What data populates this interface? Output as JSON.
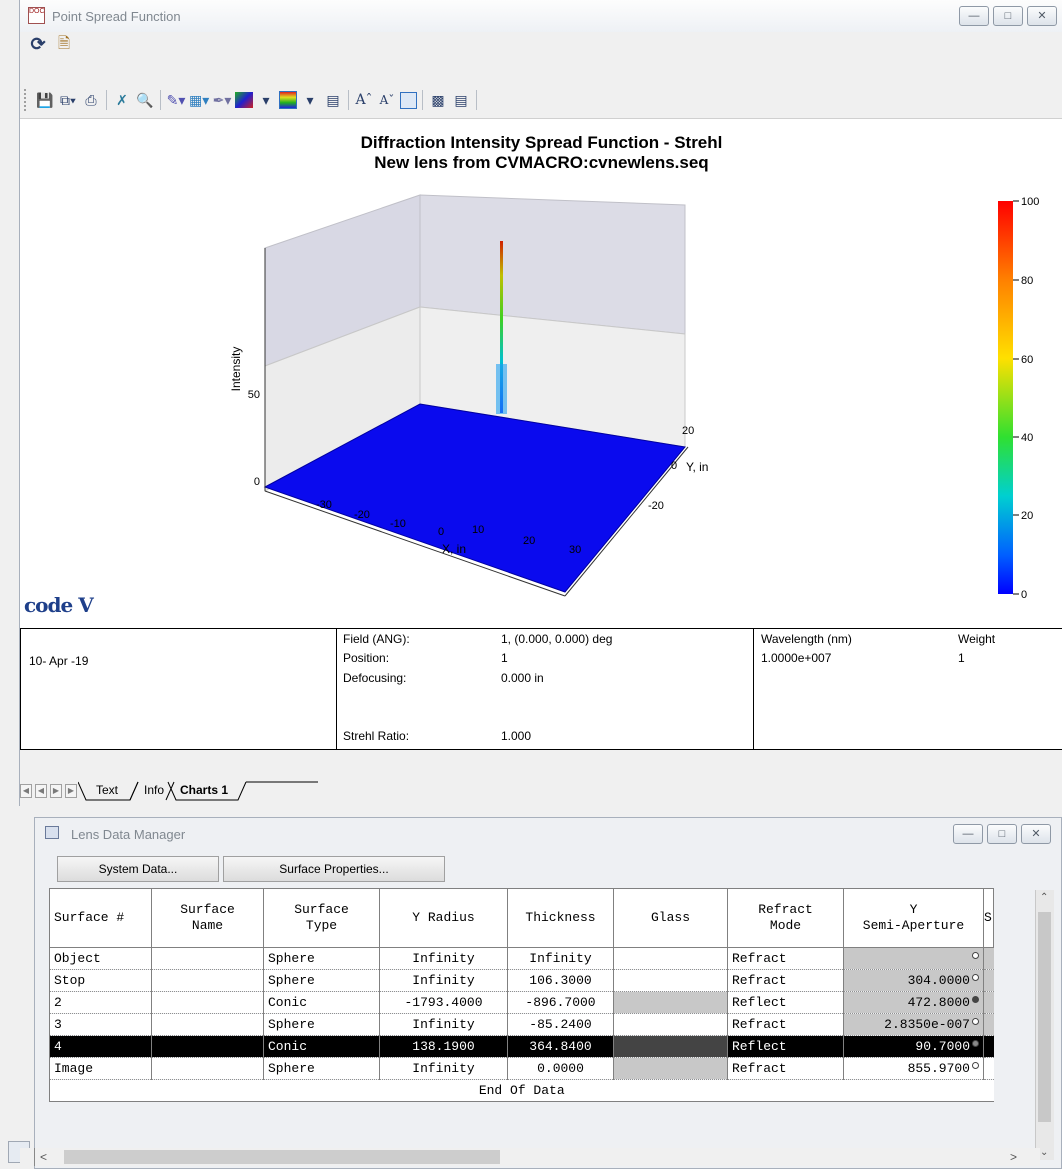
{
  "psf_window": {
    "title": "Point Spread Function",
    "icon": "document-icon",
    "controls": [
      "minimize-icon",
      "maximize-icon",
      "close-icon"
    ]
  },
  "toolbar_top": [
    "refresh-icon",
    "export-icon"
  ],
  "toolbar_main": [
    "save-icon",
    "copy-icon",
    "print-icon",
    "fit-icon",
    "zoom-icon",
    "paint-icon",
    "color-map-icon",
    "brush-icon",
    "gradient-icon",
    "legend-icon",
    "table-icon",
    "font-up-icon",
    "font-down-icon",
    "frame-icon",
    "grid-icon",
    "list-icon"
  ],
  "chart": {
    "title_line1": "Diffraction Intensity Spread Function - Strehl",
    "title_line2": "New lens from CVMACRO:cvnewlens.seq",
    "logo": "code V"
  },
  "chart_data": {
    "type": "surface3d",
    "title": "Diffraction Intensity Spread Function - Strehl",
    "subtitle": "New lens from CVMACRO:cvnewlens.seq",
    "xlabel": "X, in",
    "ylabel": "Y, in",
    "zlabel": "Intensity",
    "x_ticks": [
      "-30",
      "-20",
      "-10",
      "0",
      "10",
      "20",
      "30"
    ],
    "y_ticks": [
      "20",
      "0",
      "-20"
    ],
    "z_ticks": [
      "0",
      "50"
    ],
    "peak": {
      "x": 0,
      "y": 0,
      "z": 100
    },
    "colorbar": {
      "ticks": [
        "100",
        "80",
        "60",
        "40",
        "20",
        "0"
      ],
      "min": 0,
      "max": 100
    }
  },
  "info": {
    "date": "10- Apr -19",
    "field_label": "Field (ANG):",
    "field_value": "1, (0.000, 0.000) deg",
    "position_label": "Position:",
    "position_value": "1",
    "defocus_label": "Defocusing:",
    "defocus_value": "0.000 in",
    "strehl_label": "Strehl Ratio:",
    "strehl_value": "1.000",
    "wavelength_label": "Wavelength (nm)",
    "wavelength_value": "1.0000e+007",
    "weight_label": "Weight",
    "weight_value": "1"
  },
  "tabs": [
    {
      "label": "Text"
    },
    {
      "label": "Info"
    },
    {
      "label": "Charts 1"
    }
  ],
  "ldm": {
    "title": "Lens Data Manager",
    "system_data_button": "System Data...",
    "surface_props_button": "Surface Properties...",
    "headers": {
      "surface": "Surface #",
      "name_1": "Surface",
      "name_2": "Name",
      "type_1": "Surface",
      "type_2": "Type",
      "radius": "Y Radius",
      "thickness": "Thickness",
      "glass": "Glass",
      "mode_1": "Refract",
      "mode_2": "Mode",
      "aperture_1": "Y",
      "aperture_2": "Semi-Aperture",
      "extra": "S"
    },
    "rows": [
      {
        "surface": "Object",
        "type": "Sphere",
        "radius": "Infinity",
        "thickness": "Infinity",
        "mode": "Refract",
        "aperture": ""
      },
      {
        "surface": "Stop",
        "type": "Sphere",
        "radius": "Infinity",
        "thickness": "106.3000",
        "mode": "Refract",
        "aperture": "304.0000"
      },
      {
        "surface": "2",
        "type": "Conic",
        "radius": "-1793.4000",
        "thickness": "-896.7000",
        "mode": "Reflect",
        "aperture": "472.8000"
      },
      {
        "surface": "3",
        "type": "Sphere",
        "radius": "Infinity",
        "thickness": "-85.2400",
        "mode": "Refract",
        "aperture": "2.8350e-007"
      },
      {
        "surface": "4",
        "type": "Conic",
        "radius": "138.1900",
        "thickness": "364.8400",
        "mode": "Reflect",
        "aperture": "90.7000"
      },
      {
        "surface": "Image",
        "type": "Sphere",
        "radius": "Infinity",
        "thickness": "0.0000",
        "mode": "Refract",
        "aperture": "855.9700"
      }
    ],
    "end_text": "End Of Data"
  }
}
